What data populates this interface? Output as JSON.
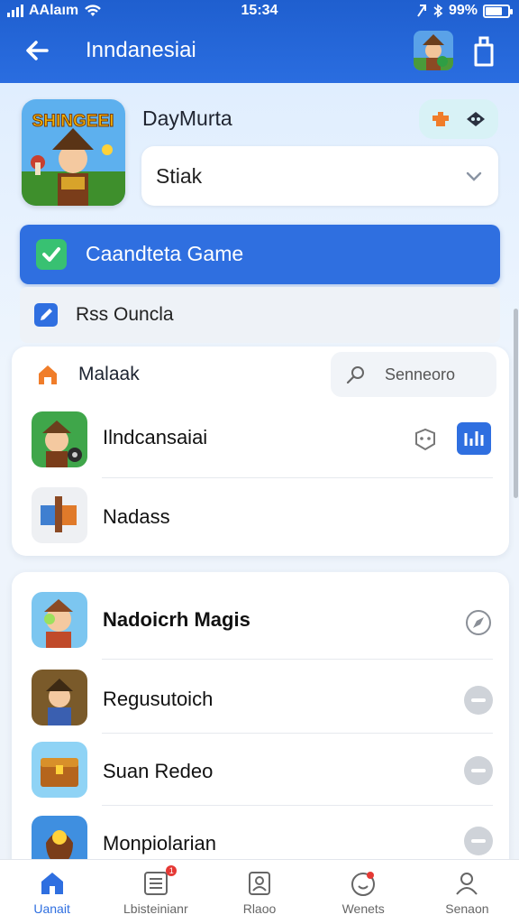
{
  "status_bar": {
    "carrier": "AAlaım",
    "time": "15:34",
    "battery": "99%"
  },
  "app_bar": {
    "title": "Inndanesiai"
  },
  "game": {
    "logo_text": "SHINGEEI",
    "title": "DayMurta",
    "select_value": "Stiak"
  },
  "primary_button": {
    "label": "Caandteta Game"
  },
  "option_row": {
    "label": "Rss Ouncla"
  },
  "section": {
    "label": "Malaak",
    "search_placeholder": "Senneoro"
  },
  "list1": [
    {
      "label": "Ilndcansaiai"
    },
    {
      "label": "Nadass"
    }
  ],
  "list2": [
    {
      "label": "Nadoicrh Magis"
    },
    {
      "label": "Regusutoich"
    },
    {
      "label": "Suan Redeo"
    },
    {
      "label": "Monpiolarian"
    }
  ],
  "bottom_nav": [
    {
      "label": "Uanait",
      "icon": "home-icon"
    },
    {
      "label": "Lbisteinianr",
      "icon": "list-icon",
      "badge": "1"
    },
    {
      "label": "Rlaoo",
      "icon": "profile-card-icon"
    },
    {
      "label": "Wenets",
      "icon": "smiley-icon"
    },
    {
      "label": "Senaon",
      "icon": "person-icon"
    }
  ],
  "colors": {
    "primary": "#2f6fe0",
    "appbar": "#1f5fcf",
    "success": "#38c172",
    "accent_orange": "#f07d2a"
  }
}
